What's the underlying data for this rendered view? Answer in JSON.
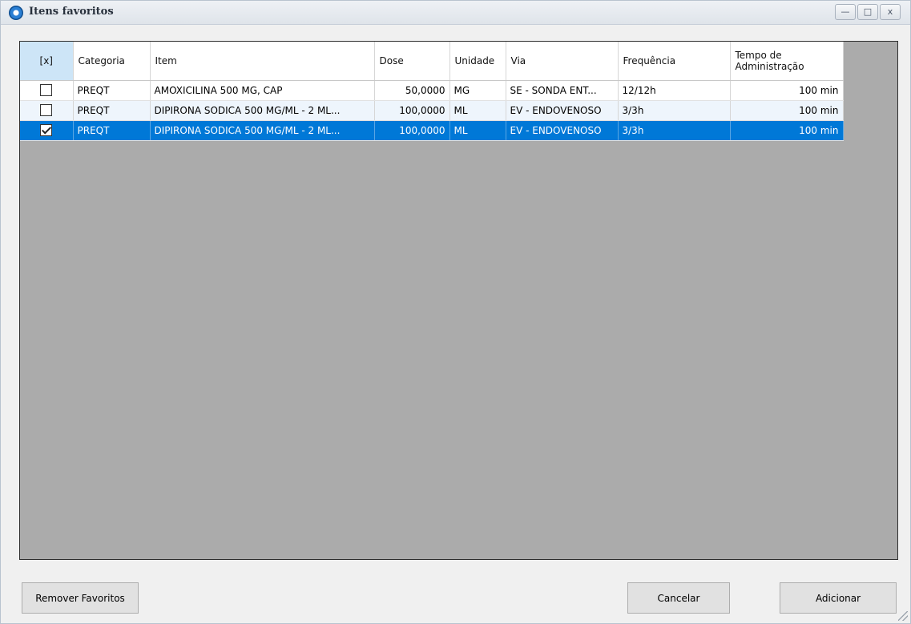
{
  "window": {
    "title": "Itens favoritos",
    "controls": {
      "minimize": "—",
      "maximize": "□",
      "close": "x"
    }
  },
  "grid": {
    "columns": {
      "check": "[x]",
      "categoria": "Categoria",
      "item": "Item",
      "dose": "Dose",
      "unidade": "Unidade",
      "via": "Via",
      "frequencia": "Frequência",
      "tempo_line1": "Tempo de",
      "tempo_line2": "Administração"
    },
    "rows": [
      {
        "checked": false,
        "categoria": "PREQT",
        "item": "AMOXICILINA 500 MG, CAP",
        "dose": "50,0000",
        "unidade": "MG",
        "via": "SE - SONDA ENT...",
        "frequencia": "12/12h",
        "tempo": "100 min"
      },
      {
        "checked": false,
        "categoria": "PREQT",
        "item": "DIPIRONA SODICA 500 MG/ML - 2 ML...",
        "dose": "100,0000",
        "unidade": "ML",
        "via": "EV - ENDOVENOSO",
        "frequencia": "3/3h",
        "tempo": "100 min"
      },
      {
        "checked": true,
        "categoria": "PREQT",
        "item": "DIPIRONA SODICA 500 MG/ML - 2 ML...",
        "dose": "100,0000",
        "unidade": "ML",
        "via": "EV - ENDOVENOSO",
        "frequencia": "3/3h",
        "tempo": "100 min"
      }
    ]
  },
  "buttons": {
    "remove": "Remover Favoritos",
    "cancel": "Cancelar",
    "add": "Adicionar"
  },
  "colors": {
    "selection": "#0078d7",
    "grid_background": "#ababab",
    "header_check_column": "#cde5f7"
  }
}
